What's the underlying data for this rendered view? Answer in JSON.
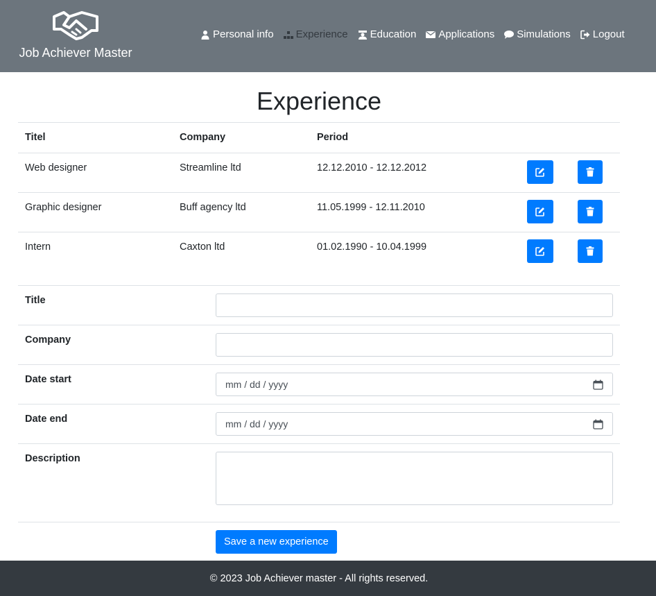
{
  "brand": {
    "name": "Job Achiever Master",
    "logo_icon": "handshake-icon"
  },
  "nav": {
    "items": [
      {
        "label": "Personal info",
        "icon": "user-icon"
      },
      {
        "label": "Experience",
        "icon": "sitemap-icon",
        "active": true
      },
      {
        "label": "Education",
        "icon": "graduate-icon"
      },
      {
        "label": "Applications",
        "icon": "envelope-icon"
      },
      {
        "label": "Simulations",
        "icon": "comment-icon"
      },
      {
        "label": "Logout",
        "icon": "sign-out-icon"
      }
    ]
  },
  "page": {
    "title": "Experience"
  },
  "table": {
    "headers": [
      "Titel",
      "Company",
      "Period"
    ],
    "rows": [
      {
        "title": "Web designer",
        "company": "Streamline ltd",
        "period": "12.12.2010 - 12.12.2012"
      },
      {
        "title": "Graphic designer",
        "company": "Buff agency ltd",
        "period": "11.05.1999 - 12.11.2010"
      },
      {
        "title": "Intern",
        "company": "Caxton ltd",
        "period": "01.02.1990 - 10.04.1999"
      }
    ],
    "edit_icon": "edit-icon",
    "delete_icon": "trash-icon"
  },
  "form": {
    "title_label": "Title",
    "title_value": "",
    "company_label": "Company",
    "company_value": "",
    "date_start_label": "Date start",
    "date_start_placeholder": "mm / dd / yyyy",
    "date_end_label": "Date end",
    "date_end_placeholder": "mm / dd / yyyy",
    "description_label": "Description",
    "description_value": "",
    "save_label": "Save a new experience"
  },
  "footer": {
    "text": "© 2023 Job Achiever master - All rights reserved."
  },
  "colors": {
    "header_bg": "#6c757d",
    "footer_bg": "#343a40",
    "primary": "#007bff",
    "active_nav": "#343a40"
  }
}
